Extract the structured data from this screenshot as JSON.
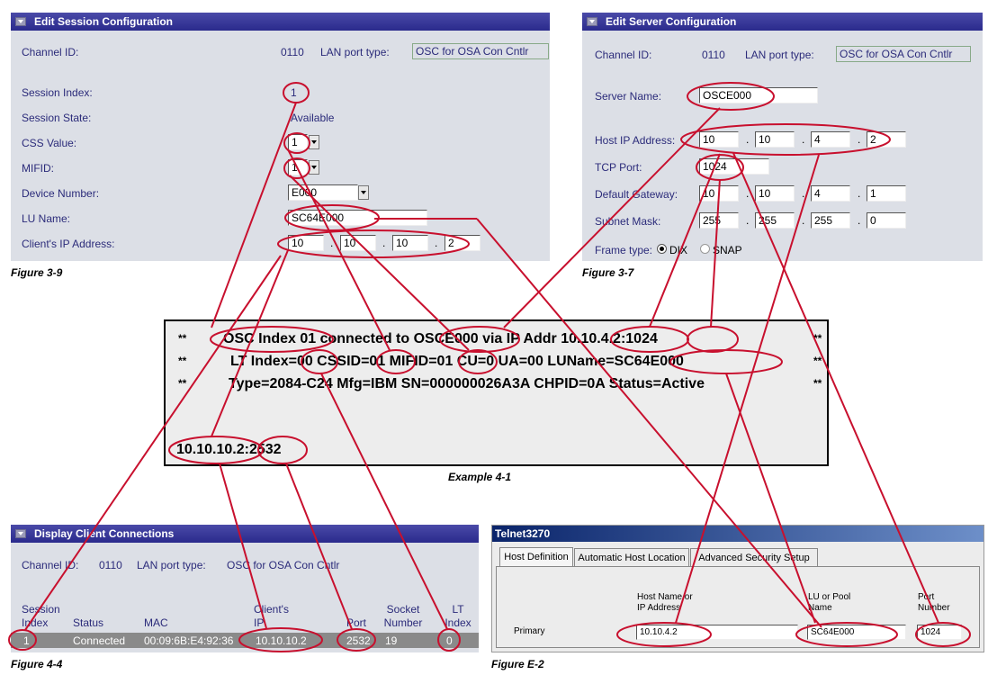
{
  "session_config": {
    "title": "Edit Session Configuration",
    "channel_id_label": "Channel ID:",
    "channel_id": "0110",
    "lan_port_label": "LAN port type:",
    "lan_port_value": "OSC for OSA Con Cntlr",
    "session_index_label": "Session Index:",
    "session_index": "1",
    "session_state_label": "Session State:",
    "session_state": "Available",
    "css_label": "CSS Value:",
    "css_value": "1",
    "mifid_label": "MIFID:",
    "mifid_value": "1",
    "device_number_label": "Device Number:",
    "device_number": "E000",
    "lu_name_label": "LU Name:",
    "lu_name": "SC64E000",
    "client_ip_label": "Client's IP Address:",
    "client_ip": [
      "10",
      "10",
      "10",
      "2"
    ],
    "figure": "Figure 3-9"
  },
  "server_config": {
    "title": "Edit Server Configuration",
    "channel_id_label": "Channel ID:",
    "channel_id": "0110",
    "lan_port_label": "LAN port type:",
    "lan_port_value": "OSC for OSA Con Cntlr",
    "server_name_label": "Server Name:",
    "server_name": "OSCE000",
    "host_ip_label": "Host IP Address:",
    "host_ip": [
      "10",
      "10",
      "4",
      "2"
    ],
    "tcp_port_label": "TCP Port:",
    "tcp_port": "1024",
    "gateway_label": "Default Gateway:",
    "gateway": [
      "10",
      "10",
      "4",
      "1"
    ],
    "subnet_label": "Subnet Mask:",
    "subnet": [
      "255",
      "255",
      "255",
      "0"
    ],
    "frame_type_label": "Frame type:",
    "frame_dix": "DIX",
    "frame_snap": "SNAP",
    "figure": "Figure 3-7"
  },
  "example": {
    "line1_stars": "**",
    "line1": "OSC Index 01 connected to OSCE000 via IP Addr 10.10.4.2:1024",
    "line2": "LT Index=00 CSSID=01 MIFID=01 CU=0  UA=00  LUName=SC64E000",
    "line3": "Type=2084-C24 Mfg=IBM SN=000000026A3A CHPID=0A Status=Active",
    "line4": "10.10.10.2:2532",
    "caption": "Example 4-1"
  },
  "client_connections": {
    "title": "Display Client Connections",
    "channel_id_label": "Channel ID:",
    "channel_id": "0110",
    "lan_port_label": "LAN port type:",
    "lan_port_value": "OSC for OSA Con Cntlr",
    "headers": {
      "session_index": "Session Index",
      "status": "Status",
      "mac": "MAC",
      "client_ip": "Client's IP",
      "port": "Port",
      "socket_number": "Socket Number",
      "lt_index": "LT Index"
    },
    "row": {
      "session_index": "1",
      "status": "Connected",
      "mac": "00:09:6B:E4:92:36",
      "client_ip": "10.10.10.2",
      "port": "2532",
      "socket_number": "19",
      "lt_index": "0"
    },
    "figure": "Figure 4-4"
  },
  "telnet": {
    "title": "Telnet3270",
    "tabs": [
      "Host Definition",
      "Automatic Host Location",
      "Advanced Security Setup"
    ],
    "host_header": "Host Name or IP Address",
    "lu_header": "LU or Pool Name",
    "port_header": "Port Number",
    "row_label": "Primary",
    "host_value": "10.10.4.2",
    "lu_value": "SC64E000",
    "port_value": "1024",
    "figure": "Figure E-2"
  },
  "colors": {
    "panel_bg": "#dcdfe6",
    "title_bar": "#2a2a8c",
    "label_text": "#2b2b7a",
    "callout": "#c8102e"
  }
}
